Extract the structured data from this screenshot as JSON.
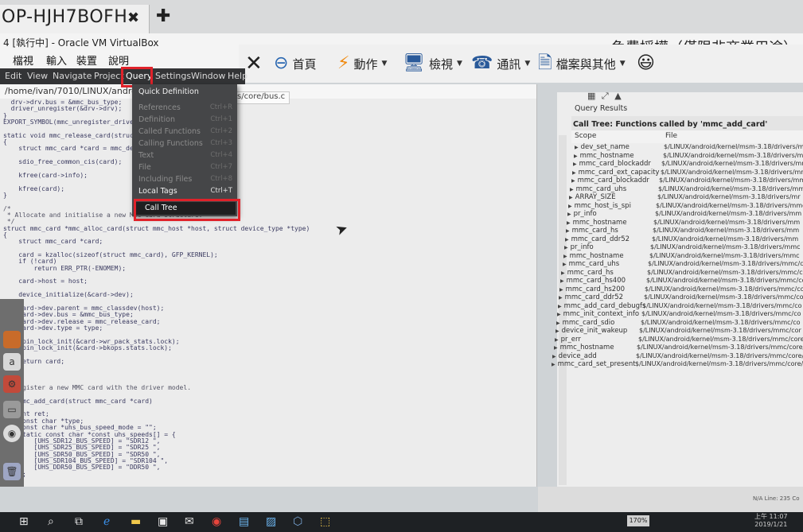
{
  "remote_desktop": {
    "tab_title": "OP-HJH7BOFH",
    "close_glyph": "✖",
    "new_tab_glyph": "✚",
    "license_text": "免費授權（僅限非商業用途）",
    "toolbar": [
      {
        "icon": "close-icon",
        "glyph": "✕",
        "label": ""
      },
      {
        "icon": "home-icon",
        "glyph": "⊖",
        "label": "首頁"
      },
      {
        "icon": "lightning-icon",
        "glyph": "⚡",
        "label": "動作"
      },
      {
        "icon": "monitor-icon",
        "glyph": "🖥",
        "label": "檢視"
      },
      {
        "icon": "phone-icon",
        "glyph": "☎",
        "label": "通訊"
      },
      {
        "icon": "files-icon",
        "glyph": "🗎",
        "label": "檔案與其他"
      },
      {
        "icon": "smiley-icon",
        "glyph": "😃",
        "label": ""
      }
    ]
  },
  "virtualbox": {
    "title": "4 [執行中] - Oracle VM VirtualBox",
    "menu": [
      "檔視",
      "輸入",
      "裝置",
      "說明"
    ]
  },
  "ide": {
    "menu": [
      "Edit",
      "View",
      "Navigate",
      "Project",
      "Query",
      "Settings",
      "Window",
      "Help"
    ],
    "path": "/home/ivan/7010/LINUX/androi",
    "file_tab": "s/core/bus.c",
    "code_lines": [
      "  drv->drv.bus = &mmc_bus_type;",
      "  driver_unregister(&drv->drv);",
      "}",
      "EXPORT_SYMBOL(mmc_unregister_drive",
      "",
      "static void mmc_release_card(struct d",
      "{",
      "    struct mmc_card *card = mmc_de",
      "",
      "    sdio_free_common_cis(card);",
      "",
      "    kfree(card->info);",
      "",
      "    kfree(card);",
      "}",
      "",
      "/*",
      " * Allocate and initialise a new MMC card structure.",
      " */",
      "struct mmc_card *mmc_alloc_card(struct mmc_host *host, struct device_type *type)",
      "{",
      "    struct mmc_card *card;",
      "",
      "    card = kzalloc(sizeof(struct mmc_card), GFP_KERNEL);",
      "    if (!card)",
      "        return ERR_PTR(-ENOMEM);",
      "",
      "    card->host = host;",
      "",
      "    device_initialize(&card->dev);",
      "",
      "    card->dev.parent = mmc_classdev(host);",
      "    card->dev.bus = &mmc_bus_type;",
      "    card->dev.release = mmc_release_card;",
      "    card->dev.type = type;",
      "",
      "    spin_lock_init(&card->wr_pack_stats.lock);",
      "    spin_lock_init(&card->bkops.stats.lock);",
      "",
      "    return card;",
      "}",
      "",
      "/*",
      " * Register a new MMC card with the driver model.",
      " */",
      "int mmc_add_card(struct mmc_card *card)",
      "{",
      "    int ret;",
      "    const char *type;",
      "    const char *uhs_bus_speed_mode = \"\";",
      "    static const char *const uhs_speeds[] = {",
      "        [UHS_SDR12_BUS_SPEED] = \"SDR12 \",",
      "        [UHS_SDR25_BUS_SPEED] = \"SDR25 \",",
      "        [UHS_SDR50_BUS_SPEED] = \"SDR50 \",",
      "        [UHS_SDR104_BUS_SPEED] = \"SDR104 \",",
      "        [UHS_DDR50_BUS_SPEED] = \"DDR50 \",",
      "    };"
    ],
    "query_menu": [
      {
        "label": "Quick Definition",
        "shortcut": "",
        "enabled": true
      },
      {
        "label": "References",
        "shortcut": "Ctrl+R",
        "enabled": false
      },
      {
        "label": "Definition",
        "shortcut": "Ctrl+1",
        "enabled": false
      },
      {
        "label": "Called Functions",
        "shortcut": "Ctrl+2",
        "enabled": false
      },
      {
        "label": "Calling Functions",
        "shortcut": "Ctrl+3",
        "enabled": false
      },
      {
        "label": "Text",
        "shortcut": "Ctrl+4",
        "enabled": false
      },
      {
        "label": "File",
        "shortcut": "Ctrl+7",
        "enabled": false
      },
      {
        "label": "Including Files",
        "shortcut": "Ctrl+8",
        "enabled": false
      },
      {
        "label": "Local Tags",
        "shortcut": "Ctrl+T",
        "enabled": true
      },
      {
        "label": "Call Tree",
        "shortcut": "",
        "enabled": true,
        "hover": true
      }
    ]
  },
  "query_results": {
    "title": "Query Results",
    "header": "Call Tree: Functions called by 'mmc_add_card'",
    "col_scope": "Scope",
    "col_file": "File",
    "rows": [
      {
        "scope": "dev_set_name",
        "file": "$/LINUX/android/kernel/msm-3.18/drivers/m"
      },
      {
        "scope": "mmc_hostname",
        "file": "$/LINUX/android/kernel/msm-3.18/drivers/m"
      },
      {
        "scope": "mmc_card_blockaddr",
        "file": "$/LINUX/android/kernel/msm-3.18/drivers/mr"
      },
      {
        "scope": "mmc_card_ext_capacity",
        "file": "$/LINUX/android/kernel/msm-3.18/drivers/mr"
      },
      {
        "scope": "mmc_card_blockaddr",
        "file": "$/LINUX/android/kernel/msm-3.18/drivers/mm"
      },
      {
        "scope": "mmc_card_uhs",
        "file": "$/LINUX/android/kernel/msm-3.18/drivers/mm"
      },
      {
        "scope": "ARRAY_SIZE",
        "file": "$/LINUX/android/kernel/msm-3.18/drivers/mr"
      },
      {
        "scope": "mmc_host_is_spi",
        "file": "$/LINUX/android/kernel/msm-3.18/drivers/mmc"
      },
      {
        "scope": "pr_info",
        "file": "$/LINUX/android/kernel/msm-3.18/drivers/mm"
      },
      {
        "scope": "mmc_hostname",
        "file": "$/LINUX/android/kernel/msm-3.18/drivers/mm"
      },
      {
        "scope": "mmc_card_hs",
        "file": "$/LINUX/android/kernel/msm-3.18/drivers/mm"
      },
      {
        "scope": "mmc_card_ddr52",
        "file": "$/LINUX/android/kernel/msm-3.18/drivers/mm"
      },
      {
        "scope": "pr_info",
        "file": "$/LINUX/android/kernel/msm-3.18/drivers/mmc"
      },
      {
        "scope": "mmc_hostname",
        "file": "$/LINUX/android/kernel/msm-3.18/drivers/mmc"
      },
      {
        "scope": "mmc_card_uhs",
        "file": "$/LINUX/android/kernel/msm-3.18/drivers/mmc/co"
      },
      {
        "scope": "mmc_card_hs",
        "file": "$/LINUX/android/kernel/msm-3.18/drivers/mmc/co"
      },
      {
        "scope": "mmc_card_hs400",
        "file": "$/LINUX/android/kernel/msm-3.18/drivers/mmc/co"
      },
      {
        "scope": "mmc_card_hs200",
        "file": "$/LINUX/android/kernel/msm-3.18/drivers/mmc/co"
      },
      {
        "scope": "mmc_card_ddr52",
        "file": "$/LINUX/android/kernel/msm-3.18/drivers/mmc/co"
      },
      {
        "scope": "mmc_add_card_debugfs",
        "file": "$/LINUX/android/kernel/msm-3.18/drivers/mmc/co"
      },
      {
        "scope": "mmc_init_context_info",
        "file": "$/LINUX/android/kernel/msm-3.18/drivers/mmc/co"
      },
      {
        "scope": "mmc_card_sdio",
        "file": "$/LINUX/android/kernel/msm-3.18/drivers/mmc/co"
      },
      {
        "scope": "device_init_wakeup",
        "file": "$/LINUX/android/kernel/msm-3.18/drivers/mmc/cor"
      },
      {
        "scope": "pr_err",
        "file": "$/LINUX/android/kernel/msm-3.18/drivers/mmc/core/b"
      },
      {
        "scope": "mmc_hostname",
        "file": "$/LINUX/android/kernel/msm-3.18/drivers/mmc/core/bu"
      },
      {
        "scope": "device_add",
        "file": "$/LINUX/android/kernel/msm-3.18/drivers/mmc/core/bus"
      },
      {
        "scope": "mmc_card_set_present",
        "file": "$/LINUX/android/kernel/msm-3.18/drivers/mmc/core/bus."
      }
    ],
    "status": "N/A  Line: 235 Co"
  },
  "taskbar": {
    "lang": "170%",
    "clock_time": "上午 11:07",
    "clock_date": "2019/1/21",
    "icons": [
      "windows-start-icon",
      "search-icon",
      "task-view-icon",
      "edge-icon",
      "file-explorer-icon",
      "store-icon",
      "mail-icon",
      "chrome-icon",
      "photos-icon",
      "app-icon",
      "virtualbox-icon",
      "remote-desktop-icon"
    ]
  }
}
